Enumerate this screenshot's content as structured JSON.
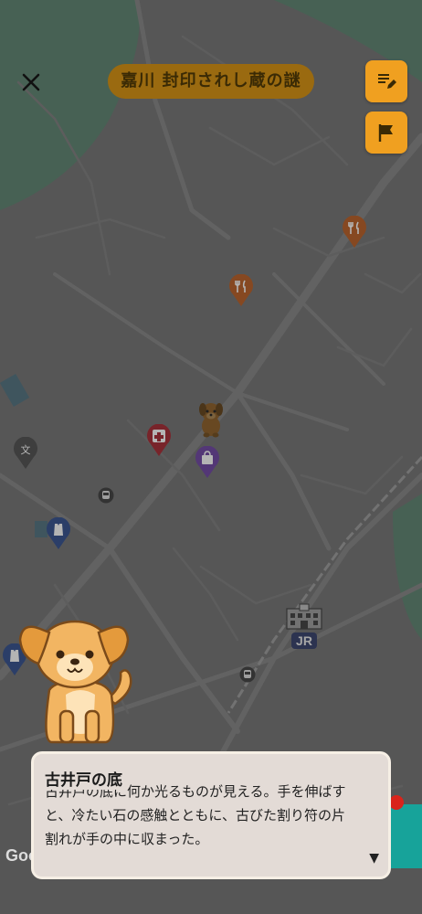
{
  "header": {
    "close_icon": "close-icon",
    "title": "嘉川 封印されし蔵の謎",
    "memo_button_icon": "edit-note-icon",
    "flag_button_icon": "flag-icon"
  },
  "map": {
    "pins": [
      {
        "name": "restaurant-pin",
        "icon": "fork-knife-icon",
        "color": "#b85a1e"
      },
      {
        "name": "restaurant-pin",
        "icon": "fork-knife-icon",
        "color": "#b85a1e"
      },
      {
        "name": "hospital-pin",
        "icon": "cross-icon",
        "color": "#a3232c"
      },
      {
        "name": "shop-pin",
        "icon": "bag-icon",
        "color": "#6a3fa0"
      },
      {
        "name": "school-pin",
        "icon": "school-icon",
        "color": "#4a4a4a"
      },
      {
        "name": "clothing-pin",
        "icon": "clothing-icon",
        "color": "#2d4a8a"
      },
      {
        "name": "clothing-pin",
        "icon": "clothing-icon",
        "color": "#2d4a8a"
      }
    ],
    "station_label": "JR",
    "attribution": "Google"
  },
  "dialog": {
    "title": "古井戸の底",
    "line1": "古井戸の底に何か光るものが見える。手を伸ばす",
    "line2": "と、冷たい石の感触とともに、古びた割り符の片",
    "line3": "割れが手の中に収まった。",
    "next_indicator": "▼"
  }
}
